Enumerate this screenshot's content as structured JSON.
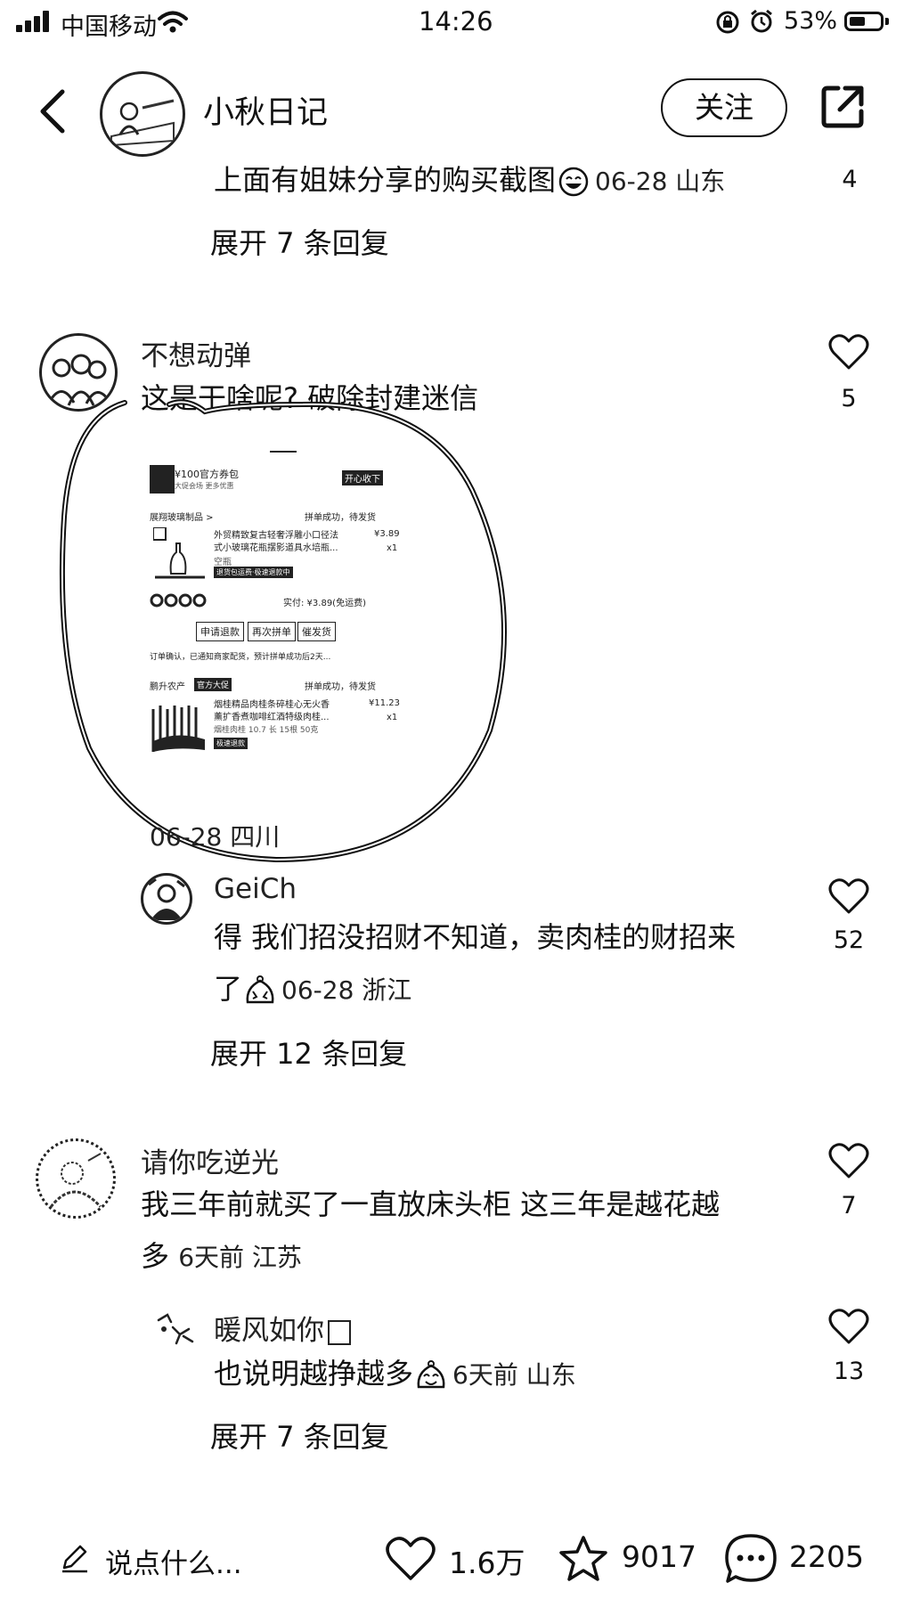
{
  "status_bar": {
    "carrier": "中国移动",
    "time": "14:26",
    "battery": "53%",
    "battery_level": 0.53
  },
  "header": {
    "title": "小秋日记",
    "follow_label": "关注"
  },
  "comments": [
    {
      "text": "上面有姐妹分享的购买截图",
      "meta": "06-28 山东",
      "likes": "4",
      "expand": "展开 7 条回复"
    },
    {
      "name": "不想动弹",
      "text": "这是干啥呢? 破除封建迷信",
      "meta": "06-28 四川",
      "likes": "5"
    },
    {
      "name": "GeiCh",
      "text_line1": "得 我们招没招财不知道，卖肉桂的财招来",
      "text_line2": "了",
      "meta": "06-28 浙江",
      "likes": "52",
      "expand": "展开 12 条回复"
    },
    {
      "name": "请你吃逆光",
      "text_line1": "我三年前就买了一直放床头柜 这三年是越花越",
      "text_line2": "多",
      "meta": "6天前 江苏",
      "likes": "7"
    },
    {
      "name": "暖风如你",
      "text": "也说明越挣越多",
      "meta": "6天前 山东",
      "likes": "13",
      "expand": "展开 7 条回复"
    }
  ],
  "screenshot": {
    "coupon": "¥100官方券包",
    "coupon_sub": "大促会场 更多优惠",
    "open_label": "开心收下",
    "shop1": "展翔玻璃制品 >",
    "status1": "拼单成功，待发货",
    "item1_line1": "外贸精致复古轻奢浮雕小口径法",
    "item1_line2": "式小玻璃花瓶摆影道具水培瓶...",
    "item1_price": "¥3.89",
    "item1_qty": "x1",
    "item1_spec": "空瓶",
    "item1_badge": "退货包运费·极速退款中",
    "paid": "实付: ¥3.89(免运费)",
    "btn_refund": "申请退款",
    "btn_regroup": "再次拼单",
    "btn_urge": "催发货",
    "notice": "订单确认，已通知商家配货，预计拼单成功后2天...",
    "shop2": "鹏升农产",
    "shop2_badge": "官方大促",
    "status2": "拼单成功，待发货",
    "item2_line1": "烟桂精品肉桂条碎桂心无火香",
    "item2_line2": "薰扩香煮咖啡红酒特级肉桂...",
    "item2_price": "¥11.23",
    "item2_qty": "x1",
    "item2_spec": "烟桂肉桂 10.7 长 15根 50克",
    "item2_badge": "极速退款"
  },
  "bottom_bar": {
    "comment_placeholder": "说点什么...",
    "likes": "1.6万",
    "favorites": "9017",
    "comments": "2205"
  }
}
